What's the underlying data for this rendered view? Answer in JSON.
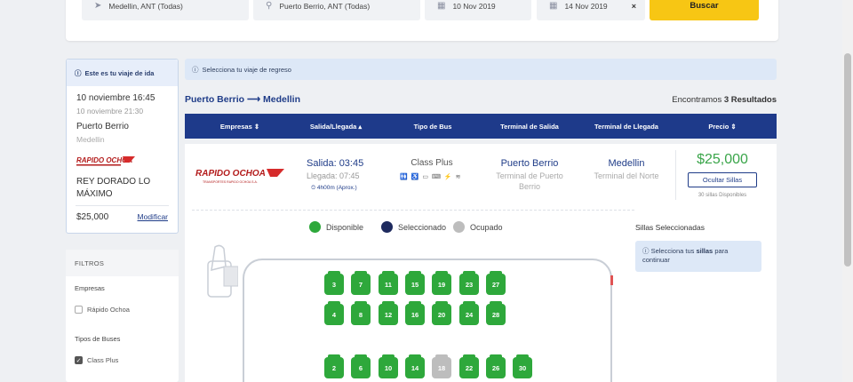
{
  "search": {
    "origin": "Medellin, ANT (Todas)",
    "destination": "Puerto Berrio, ANT (Todas)",
    "date_out": "10 Nov 2019",
    "date_return": "14 Nov 2019",
    "clear": "×",
    "button": "Buscar"
  },
  "trip": {
    "header": "Este es tu viaje de ida",
    "depart_datetime": "10 noviembre 16:45",
    "arrive_datetime": "10 noviembre 21:30",
    "origin": "Puerto Berrio",
    "destination": "Medellin",
    "company": "REY DORADO LO MÁXIMO",
    "price": "$25,000",
    "modify": "Modificar"
  },
  "filters": {
    "title": "FILTROS",
    "companies_label": "Empresas",
    "company_option": "Rápido Ochoa",
    "bus_types_label": "Tipos de Buses",
    "bus_type_option": "Class Plus"
  },
  "notice": "Selecciona tu viaje de regreso",
  "route": "Puerto Berrio ⟶ Medellin",
  "results": {
    "prefix": "Encontramos",
    "count": "3 Resultados"
  },
  "table_headers": [
    "Empresas ⇕",
    "Salida/Llegada ▴",
    "Tipo de Bus",
    "Terminal de Salida",
    "Terminal de Llegada",
    "Precio ⇕"
  ],
  "result": {
    "logo_text": "RAPIDO OCHOA",
    "logo_sub": "TRANSPORTES RAPIDO OCHOA S.A.",
    "departure": "Salida: 03:45",
    "arrival": "Llegada: 07:45",
    "duration": "⏲ 4h00m (Aprox.)",
    "bus_type": "Class Plus",
    "amenities": "🚻 ♿ ▭ ⌨ ⚡ ≋",
    "origin_city": "Puerto Berrio",
    "origin_terminal": "Terminal de Puerto Berrio",
    "dest_city": "Medellin",
    "dest_terminal": "Terminal del Norte",
    "price": "$25,000",
    "hide_seats": "Ocultar Sillas",
    "seats_available": "30 sillas Disponibles"
  },
  "legend": {
    "available": "Disponible",
    "selected": "Seleccionado",
    "occupied": "Ocupado"
  },
  "colors": {
    "available": "#2ea83b",
    "selected": "#1e2a5e",
    "occupied": "#bdbdbd",
    "brand": "#1e3a8a",
    "accent": "#f7c614"
  },
  "selected_seats": {
    "title": "Sillas Seleccionadas",
    "hint_pre": "Selecciona tus ",
    "hint_bold": "sillas",
    "hint_post": " para continuar"
  },
  "seats": {
    "row1": [
      "3",
      "7",
      "11",
      "15",
      "19",
      "23",
      "27"
    ],
    "row2": [
      "4",
      "8",
      "12",
      "16",
      "20",
      "24",
      "28"
    ],
    "row3": [
      "2",
      "6",
      "10",
      "14",
      "18",
      "22",
      "26",
      "30"
    ],
    "occupied": [
      "18"
    ]
  }
}
